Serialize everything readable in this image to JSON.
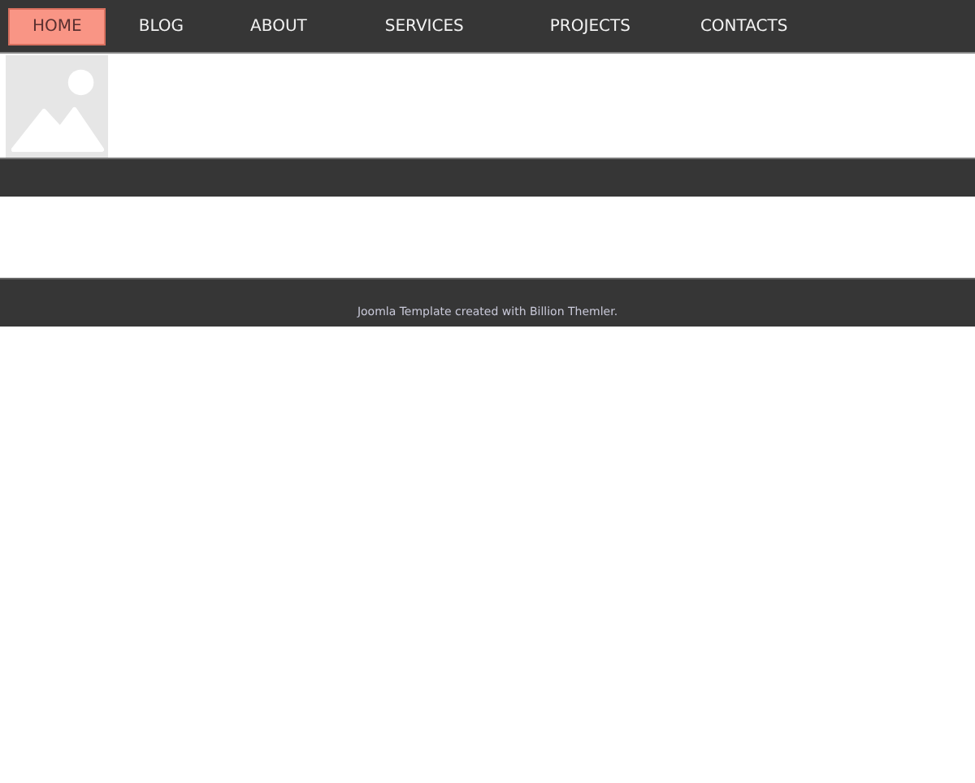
{
  "nav": [
    {
      "label": "HOME",
      "selected": true
    },
    {
      "label": "BLOG",
      "selected": false
    },
    {
      "label": "ABOUT",
      "selected": false
    },
    {
      "label": "SERVICES",
      "selected": false
    },
    {
      "label": "PROJECTS",
      "selected": false
    },
    {
      "label": "CONTACTS",
      "selected": false
    }
  ],
  "footer": {
    "text": "Joomla Template created with Billion Themler."
  }
}
